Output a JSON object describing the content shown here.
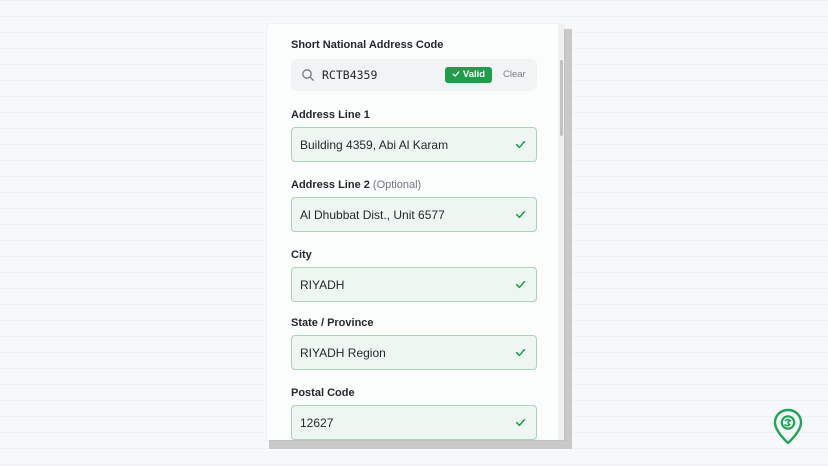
{
  "short_code": {
    "label": "Short National Address Code",
    "value": "RCTB4359",
    "badge": "Valid",
    "clear_label": "Clear"
  },
  "fields": [
    {
      "label": "Address Line 1",
      "optional": "",
      "value": "Building 4359, Abi Al Karam"
    },
    {
      "label": "Address Line 2",
      "optional": "(Optional)",
      "value": "Al Dhubbat Dist., Unit 6577"
    },
    {
      "label": "City",
      "optional": "",
      "value": "RIYADH"
    },
    {
      "label": "State / Province",
      "optional": "",
      "value": "RIYADH Region"
    },
    {
      "label": "Postal Code",
      "optional": "",
      "value": "12627"
    }
  ],
  "colors": {
    "valid_green": "#1f9d4c",
    "field_bg": "#edf6f0",
    "field_border": "#a9d3b7",
    "logo_green": "#22a35a"
  },
  "icons": {
    "search": "search-icon",
    "valid": "check-icon",
    "logo": "map-pin-logo-icon"
  }
}
